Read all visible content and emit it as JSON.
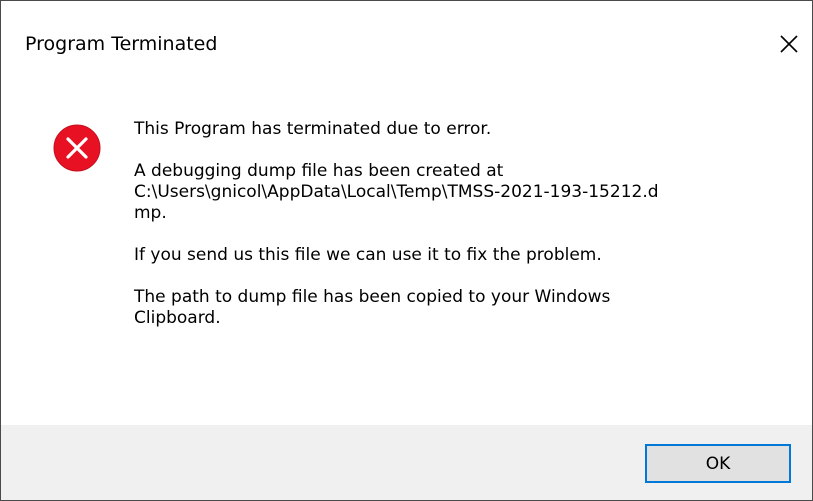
{
  "window": {
    "title": "Program Terminated"
  },
  "icons": {
    "close": "close-icon",
    "error": "error-icon"
  },
  "colors": {
    "error_red": "#e81123",
    "button_border": "#0078d7",
    "footer_bg": "#f0f0f0"
  },
  "message": {
    "line1": "This Program has terminated due to error.",
    "line2": "A debugging dump file has been created at\nC:\\Users\\gnicol\\AppData\\Local\\Temp\\TMSS-2021-193-15212.d\nmp.",
    "line3": "If you send us this file we can use it to fix the problem.",
    "line4": "The path to dump file has been copied to your Windows\nClipboard."
  },
  "buttons": {
    "ok_label": "OK"
  }
}
